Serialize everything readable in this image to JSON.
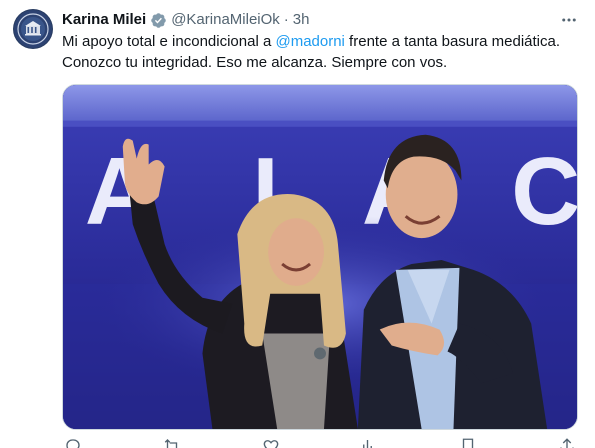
{
  "author": {
    "display_name": "Karina Milei",
    "handle": "@KarinaMileiOk",
    "separator": "·",
    "time": "3h",
    "verified": true
  },
  "tweet": {
    "text_part1": "Mi apoyo total e incondicional a ",
    "mention": "@madorni",
    "text_part2": " frente a tanta basura mediática.\nConozco tu integridad. Eso me alcanza. Siempre con vos."
  },
  "media": {
    "stage_sign": "ALA",
    "description_icon": "photo"
  },
  "actions": {
    "items": [
      "reply-icon",
      "repost-icon",
      "like-icon",
      "views-icon",
      "bookmark-icon",
      "share-icon"
    ]
  },
  "colors": {
    "accent": "#1d9bf0",
    "secondary_text": "#536471",
    "stage_purple": "#2e2fa0"
  }
}
